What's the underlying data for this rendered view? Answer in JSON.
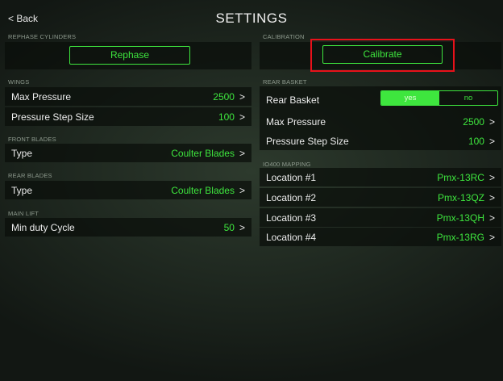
{
  "header": {
    "back_label": "< Back",
    "title": "SETTINGS"
  },
  "rephase": {
    "section": "REPHASE CYLINDERS",
    "button": "Rephase"
  },
  "calibration": {
    "section": "CALIBRATION",
    "button": "Calibrate"
  },
  "wings": {
    "section": "WINGS",
    "rows": [
      {
        "label": "Max Pressure",
        "value": "2500",
        "chevron": ">"
      },
      {
        "label": "Pressure Step Size",
        "value": "100",
        "chevron": ">"
      }
    ]
  },
  "front_blades": {
    "section": "FRONT BLADES",
    "rows": [
      {
        "label": "Type",
        "value": "Coulter Blades",
        "chevron": ">"
      }
    ]
  },
  "rear_blades": {
    "section": "REAR BLADES",
    "rows": [
      {
        "label": "Type",
        "value": "Coulter Blades",
        "chevron": ">"
      }
    ]
  },
  "main_lift": {
    "section": "MAIN LIFT",
    "rows": [
      {
        "label": "Min duty Cycle",
        "value": "50",
        "chevron": ">"
      }
    ]
  },
  "rear_basket": {
    "section": "REAR BASKET",
    "toggle_label": "Rear Basket",
    "toggle_yes": "yes",
    "toggle_no": "no",
    "toggle_selected": "yes",
    "rows": [
      {
        "label": "Max Pressure",
        "value": "2500",
        "chevron": ">"
      },
      {
        "label": "Pressure Step Size",
        "value": "100",
        "chevron": ">"
      }
    ]
  },
  "io400_mapping": {
    "section": "IO400 MAPPING",
    "rows": [
      {
        "label": "Location #1",
        "value": "Pmx-13RC",
        "chevron": ">"
      },
      {
        "label": "Location #2",
        "value": "Pmx-13QZ",
        "chevron": ">"
      },
      {
        "label": "Location #3",
        "value": "Pmx-13QH",
        "chevron": ">"
      },
      {
        "label": "Location #4",
        "value": "Pmx-13RG",
        "chevron": ">"
      }
    ]
  },
  "colors": {
    "accent": "#3ee63e",
    "highlight": "#e8111a",
    "panel": "#0a0e0a"
  }
}
